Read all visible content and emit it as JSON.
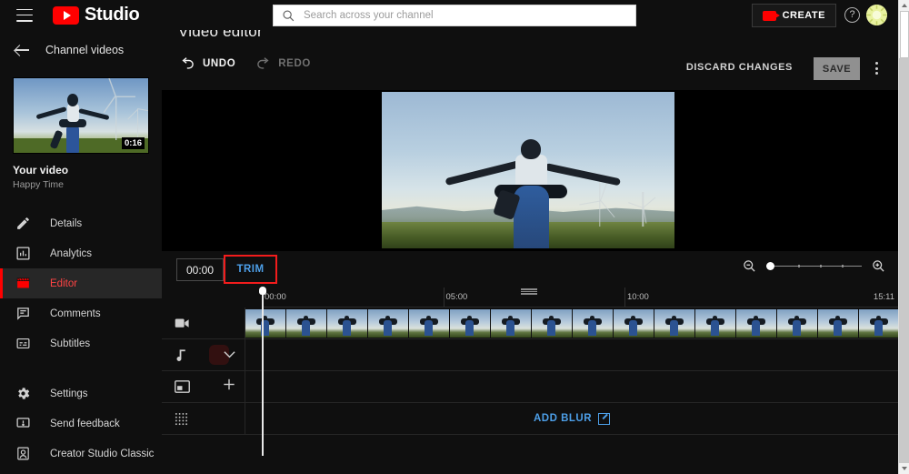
{
  "header": {
    "menu_icon": "hamburger-icon",
    "logo_icon": "youtube-logo-icon",
    "brand": "Studio",
    "search": {
      "placeholder": "Search across your channel",
      "value": "",
      "icon": "search-icon"
    },
    "create_label": "CREATE",
    "create_icon": "video-camera-icon",
    "help_icon": "help-circle-icon",
    "help_glyph": "?",
    "avatar_icon": "user-avatar",
    "avatar_color": "#e9f2a0"
  },
  "sidebar": {
    "back_icon": "back-arrow-icon",
    "channel_label": "Channel videos",
    "thumbnail": {
      "duration": "0:16",
      "name": "video-thumbnail"
    },
    "video_title": "Your video",
    "video_subtitle": "Happy Time",
    "items": [
      {
        "label": "Details",
        "icon": "pencil-icon",
        "active": false
      },
      {
        "label": "Analytics",
        "icon": "bar-chart-icon",
        "active": false
      },
      {
        "label": "Editor",
        "icon": "clapperboard-icon",
        "active": true
      },
      {
        "label": "Comments",
        "icon": "comment-icon",
        "active": false
      },
      {
        "label": "Subtitles",
        "icon": "subtitles-icon",
        "active": false
      }
    ],
    "bottom_items": [
      {
        "label": "Settings",
        "icon": "gear-icon"
      },
      {
        "label": "Send feedback",
        "icon": "feedback-icon"
      },
      {
        "label": "Creator Studio Classic",
        "icon": "creator-studio-classic-icon"
      }
    ],
    "active_color": "#ff4444"
  },
  "main": {
    "page_title": "Video editor",
    "undo": {
      "label": "UNDO",
      "icon": "undo-arrow-icon",
      "enabled": true
    },
    "redo": {
      "label": "REDO",
      "icon": "redo-arrow-icon",
      "enabled": false
    },
    "discard_label": "DISCARD CHANGES",
    "save_label": "SAVE",
    "more_icon": "kebab-menu-icon"
  },
  "timeline": {
    "current_time": "00:00",
    "trim_label": "TRIM",
    "trim_highlight_color": "#f21c1c",
    "trim_color": "#4d9fe8",
    "grip_icon": "drag-handle-icon",
    "zoom_out_icon": "zoom-out-icon",
    "zoom_in_icon": "zoom-in-icon",
    "zoom_value": 0,
    "ruler_marks": [
      "00:00",
      "05:00",
      "10:00"
    ],
    "ruler_end": "15:11",
    "playhead_time": "00:00",
    "tracks": [
      {
        "name": "video-track",
        "icon": "video-camera-icon",
        "extra": ""
      },
      {
        "name": "audio-track",
        "icon": "music-note-icon",
        "extra": "chevron-down-icon"
      },
      {
        "name": "overlay-track",
        "icon": "picture-in-picture-icon",
        "extra": "plus-icon"
      },
      {
        "name": "blur-track",
        "icon": "blur-grid-icon",
        "extra": ""
      }
    ],
    "add_blur_label": "ADD BLUR",
    "add_blur_icon": "external-link-icon",
    "frame_count": 16
  },
  "scrollbar": {
    "up_icon": "scroll-up-arrow",
    "down_icon": "scroll-down-arrow",
    "name": "page-scrollbar"
  }
}
